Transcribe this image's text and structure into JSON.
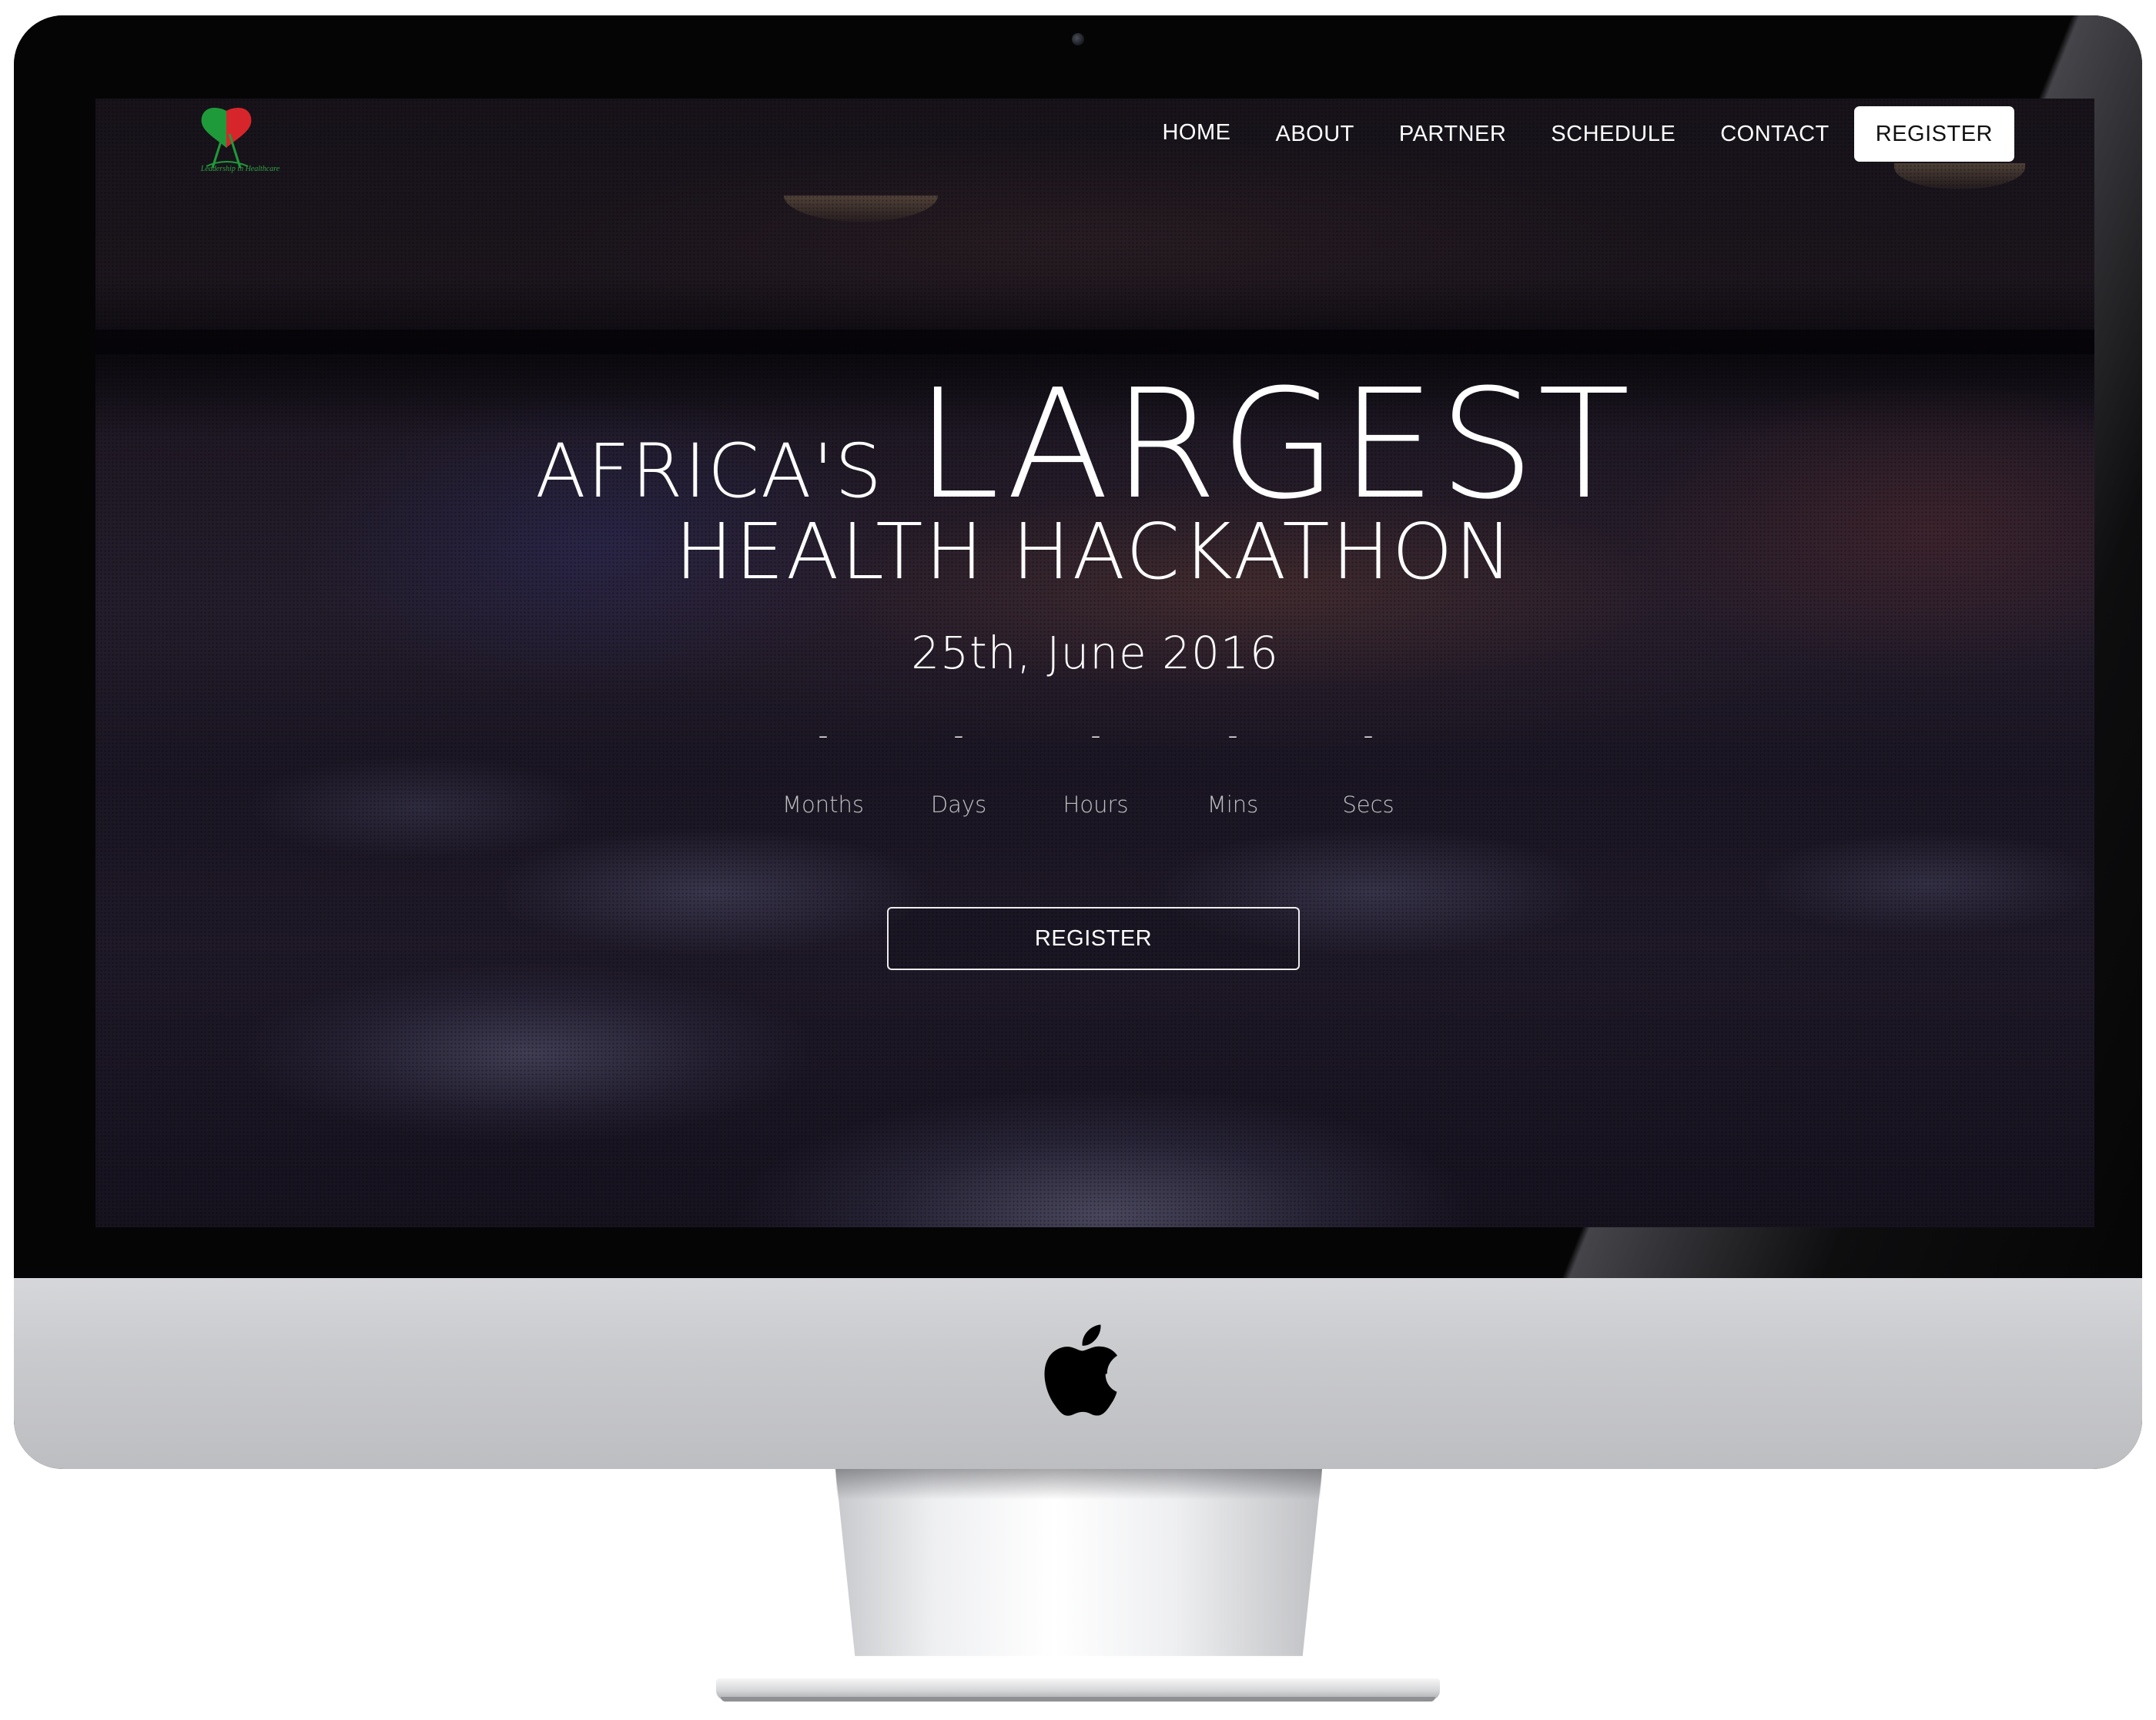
{
  "nav": {
    "items": [
      {
        "label": "HOME"
      },
      {
        "label": "ABOUT"
      },
      {
        "label": "PARTNER"
      },
      {
        "label": "SCHEDULE"
      },
      {
        "label": "CONTACT"
      }
    ],
    "register_label": "REGISTER"
  },
  "logo": {
    "icon": "heart-logo-icon",
    "tagline": "Leadership in Healthcare",
    "colors": {
      "green": "#1f9a3a",
      "red": "#d7262b"
    }
  },
  "hero": {
    "prefix": "AFRICA'S",
    "highlight": "LARGEST",
    "subtitle": "HEALTH HACKATHON",
    "date": "25th, June 2016"
  },
  "countdown": {
    "units": [
      {
        "value": "-",
        "label": "Months"
      },
      {
        "value": "-",
        "label": "Days"
      },
      {
        "value": "-",
        "label": "Hours"
      },
      {
        "value": "-",
        "label": "Mins"
      },
      {
        "value": "-",
        "label": "Secs"
      }
    ]
  },
  "cta": {
    "register_label": "REGISTER"
  },
  "device": {
    "brand_icon": "apple-icon"
  }
}
